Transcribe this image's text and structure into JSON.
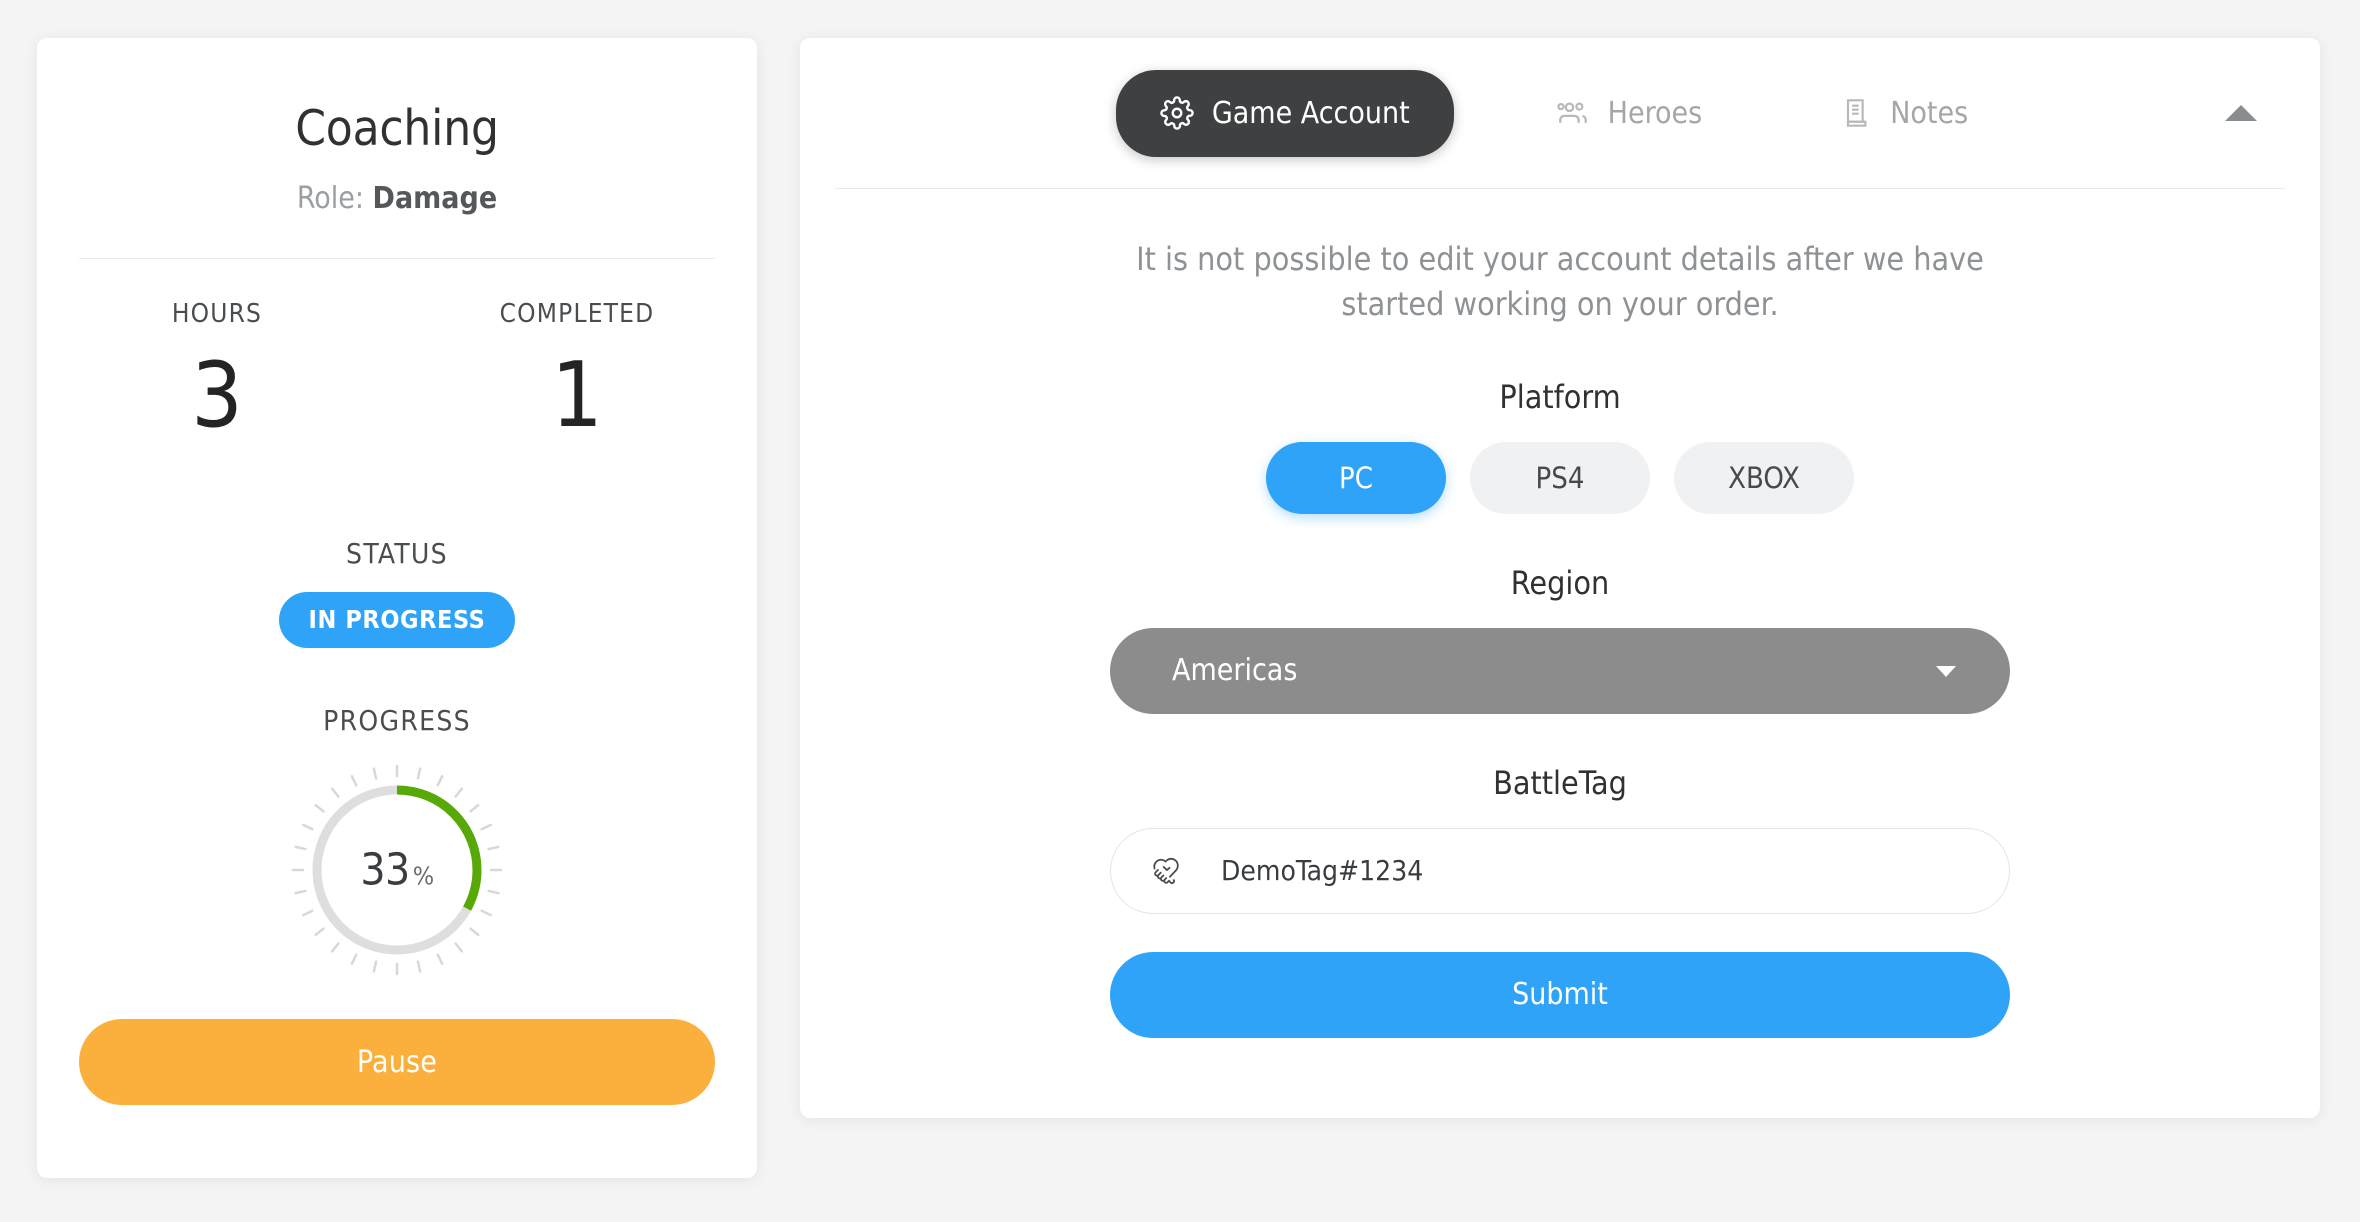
{
  "left_panel": {
    "title": "Coaching",
    "role_prefix": "Role: ",
    "role_value": "Damage",
    "stats": [
      {
        "label": "HOURS",
        "value": "3"
      },
      {
        "label": "COMPLETED",
        "value": "1"
      }
    ],
    "status_label": "STATUS",
    "status_badge": "IN PROGRESS",
    "progress_label": "PROGRESS",
    "progress_value": "33",
    "progress_percent_sign": "%",
    "progress_pct_number": 33,
    "pause_button": "Pause",
    "colors": {
      "status_badge": "#2fa3f7",
      "progress_arc": "#57a908",
      "progress_track": "#dedede",
      "pause_button": "#fbaf3d"
    }
  },
  "right_panel": {
    "tabs": [
      {
        "label": "Game Account",
        "icon": "gear-icon",
        "active": true
      },
      {
        "label": "Heroes",
        "icon": "group-icon",
        "active": false
      },
      {
        "label": "Notes",
        "icon": "notes-icon",
        "active": false
      }
    ],
    "collapse_icon": "caret-up-icon",
    "notice": "It is not possible to edit your account details after we have started working on your order.",
    "platform": {
      "label": "Platform",
      "options": [
        {
          "label": "PC",
          "selected": true
        },
        {
          "label": "PS4",
          "selected": false
        },
        {
          "label": "XBOX",
          "selected": false
        }
      ]
    },
    "region": {
      "label": "Region",
      "value": "Americas",
      "caret_icon": "caret-down-icon"
    },
    "battletag": {
      "label": "BattleTag",
      "value": "DemoTag#1234",
      "placeholder": "BattleTag",
      "icon": "handshake-icon"
    },
    "submit_button": "Submit",
    "colors": {
      "active_tab": "#3e4042",
      "accent": "#2fa3f7",
      "region_disabled": "#8c8c8c"
    }
  }
}
